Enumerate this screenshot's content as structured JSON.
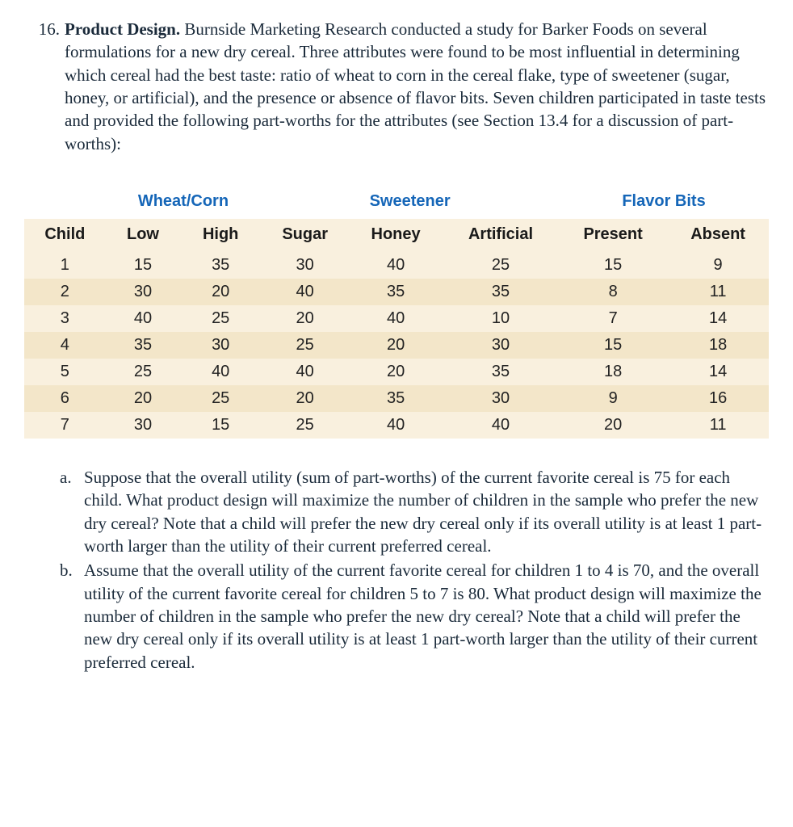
{
  "problem": {
    "number": "16.",
    "title": "Product Design.",
    "intro": "Burnside Marketing Research conducted a study for Barker Foods on several formulations for a new dry cereal. Three attributes were found to be most influential in determining which cereal had the best taste: ratio of wheat to corn in the cereal flake, type of sweetener (sugar, honey, or artificial), and the presence or absence of flavor bits. Seven children participated in taste tests and provided the following part-worths for the attributes (see Section 13.4 for a discussion of part-worths):"
  },
  "table": {
    "groups": [
      "Wheat/Corn",
      "Sweetener",
      "Flavor Bits"
    ],
    "child_header": "Child",
    "sub_headers": [
      "Low",
      "High",
      "Sugar",
      "Honey",
      "Artificial",
      "Present",
      "Absent"
    ],
    "rows": [
      {
        "child": "1",
        "values": [
          "15",
          "35",
          "30",
          "40",
          "25",
          "15",
          "9"
        ]
      },
      {
        "child": "2",
        "values": [
          "30",
          "20",
          "40",
          "35",
          "35",
          "8",
          "11"
        ]
      },
      {
        "child": "3",
        "values": [
          "40",
          "25",
          "20",
          "40",
          "10",
          "7",
          "14"
        ]
      },
      {
        "child": "4",
        "values": [
          "35",
          "30",
          "25",
          "20",
          "30",
          "15",
          "18"
        ]
      },
      {
        "child": "5",
        "values": [
          "25",
          "40",
          "40",
          "20",
          "35",
          "18",
          "14"
        ]
      },
      {
        "child": "6",
        "values": [
          "20",
          "25",
          "20",
          "35",
          "30",
          "9",
          "16"
        ]
      },
      {
        "child": "7",
        "values": [
          "30",
          "15",
          "25",
          "40",
          "40",
          "20",
          "11"
        ]
      }
    ]
  },
  "subparts": {
    "a": {
      "letter": "a.",
      "text": "Suppose that the overall utility (sum of part-worths) of the current favorite cereal is 75 for each child. What product design will maximize the number of children in the sample who prefer the new dry cereal? Note that a child will prefer the new dry cereal only if its overall utility is at least 1 part-worth larger than the utility of their current preferred cereal."
    },
    "b": {
      "letter": "b.",
      "text": "Assume that the overall utility of the current favorite cereal for children 1 to 4 is 70, and the overall utility of the current favorite cereal for children 5 to 7 is 80. What product design will maximize the number of children in the sample who prefer the new dry cereal? Note that a child will prefer the new dry cereal only if its overall utility is at least 1 part-worth larger than the utility of their current preferred cereal."
    }
  }
}
